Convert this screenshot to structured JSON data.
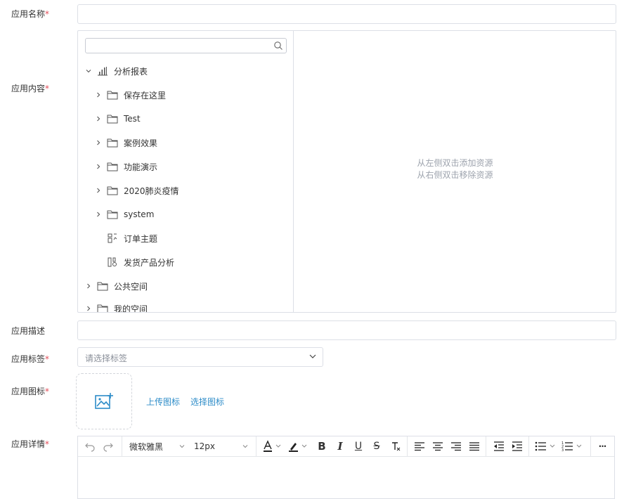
{
  "form": {
    "name_label": "应用名称",
    "content_label": "应用内容",
    "desc_label": "应用描述",
    "tag_label": "应用标签",
    "icon_label": "应用图标",
    "detail_label": "应用详情",
    "required_mark": "*"
  },
  "tree": {
    "root": "分析报表",
    "children": [
      "保存在这里",
      "Test",
      "案例效果",
      "功能演示",
      "2020肺炎疫情",
      "system"
    ],
    "leaves": [
      "订单主题",
      "发货产品分析"
    ],
    "public_space": "公共空间",
    "my_space_partial": "我的空间"
  },
  "right_panel": {
    "hint_line1": "从左侧双击添加资源",
    "hint_line2": "从右侧双击移除资源"
  },
  "tag_select": {
    "placeholder": "请选择标签"
  },
  "icon_upload": {
    "upload_link": "上传图标",
    "choose_link": "选择图标"
  },
  "editor_toolbar": {
    "font_family": "微软雅黑",
    "font_size": "12px",
    "bold": "B",
    "italic": "I",
    "underline": "U",
    "strike": "S",
    "more": "···"
  },
  "colors": {
    "accent": "#2d8cc8",
    "required": "#e34d59",
    "border": "#dcdfe6"
  }
}
